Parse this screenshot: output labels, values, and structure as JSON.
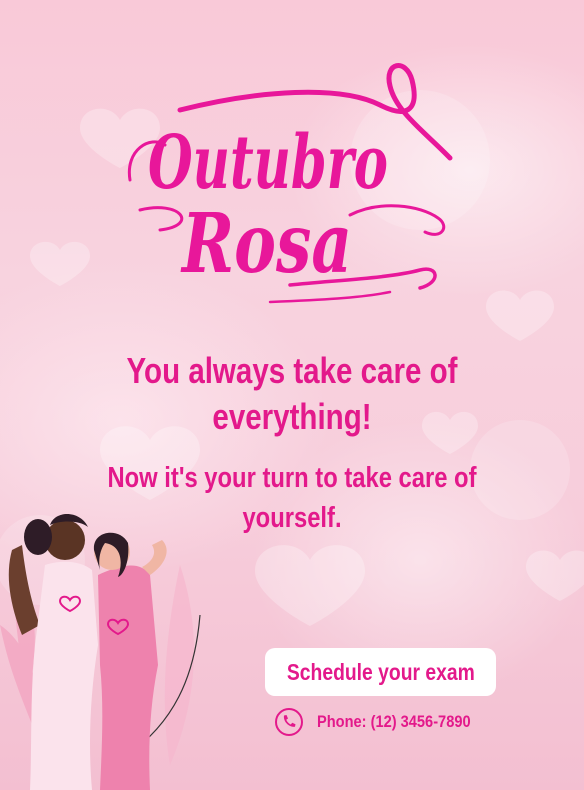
{
  "campaign": {
    "title_line1": "Outubro",
    "title_line2": "Rosa"
  },
  "message": {
    "headline": "You always take care of everything!",
    "subheadline": "Now it's your turn to take care of yourself."
  },
  "cta": {
    "button_label": "Schedule your exam"
  },
  "contact": {
    "phone_icon": "phone-icon",
    "phone_text": "Phone: (12) 3456-7890"
  },
  "colors": {
    "accent": "#e3198b",
    "background": "#f8d3df",
    "button_bg": "#ffffff"
  }
}
